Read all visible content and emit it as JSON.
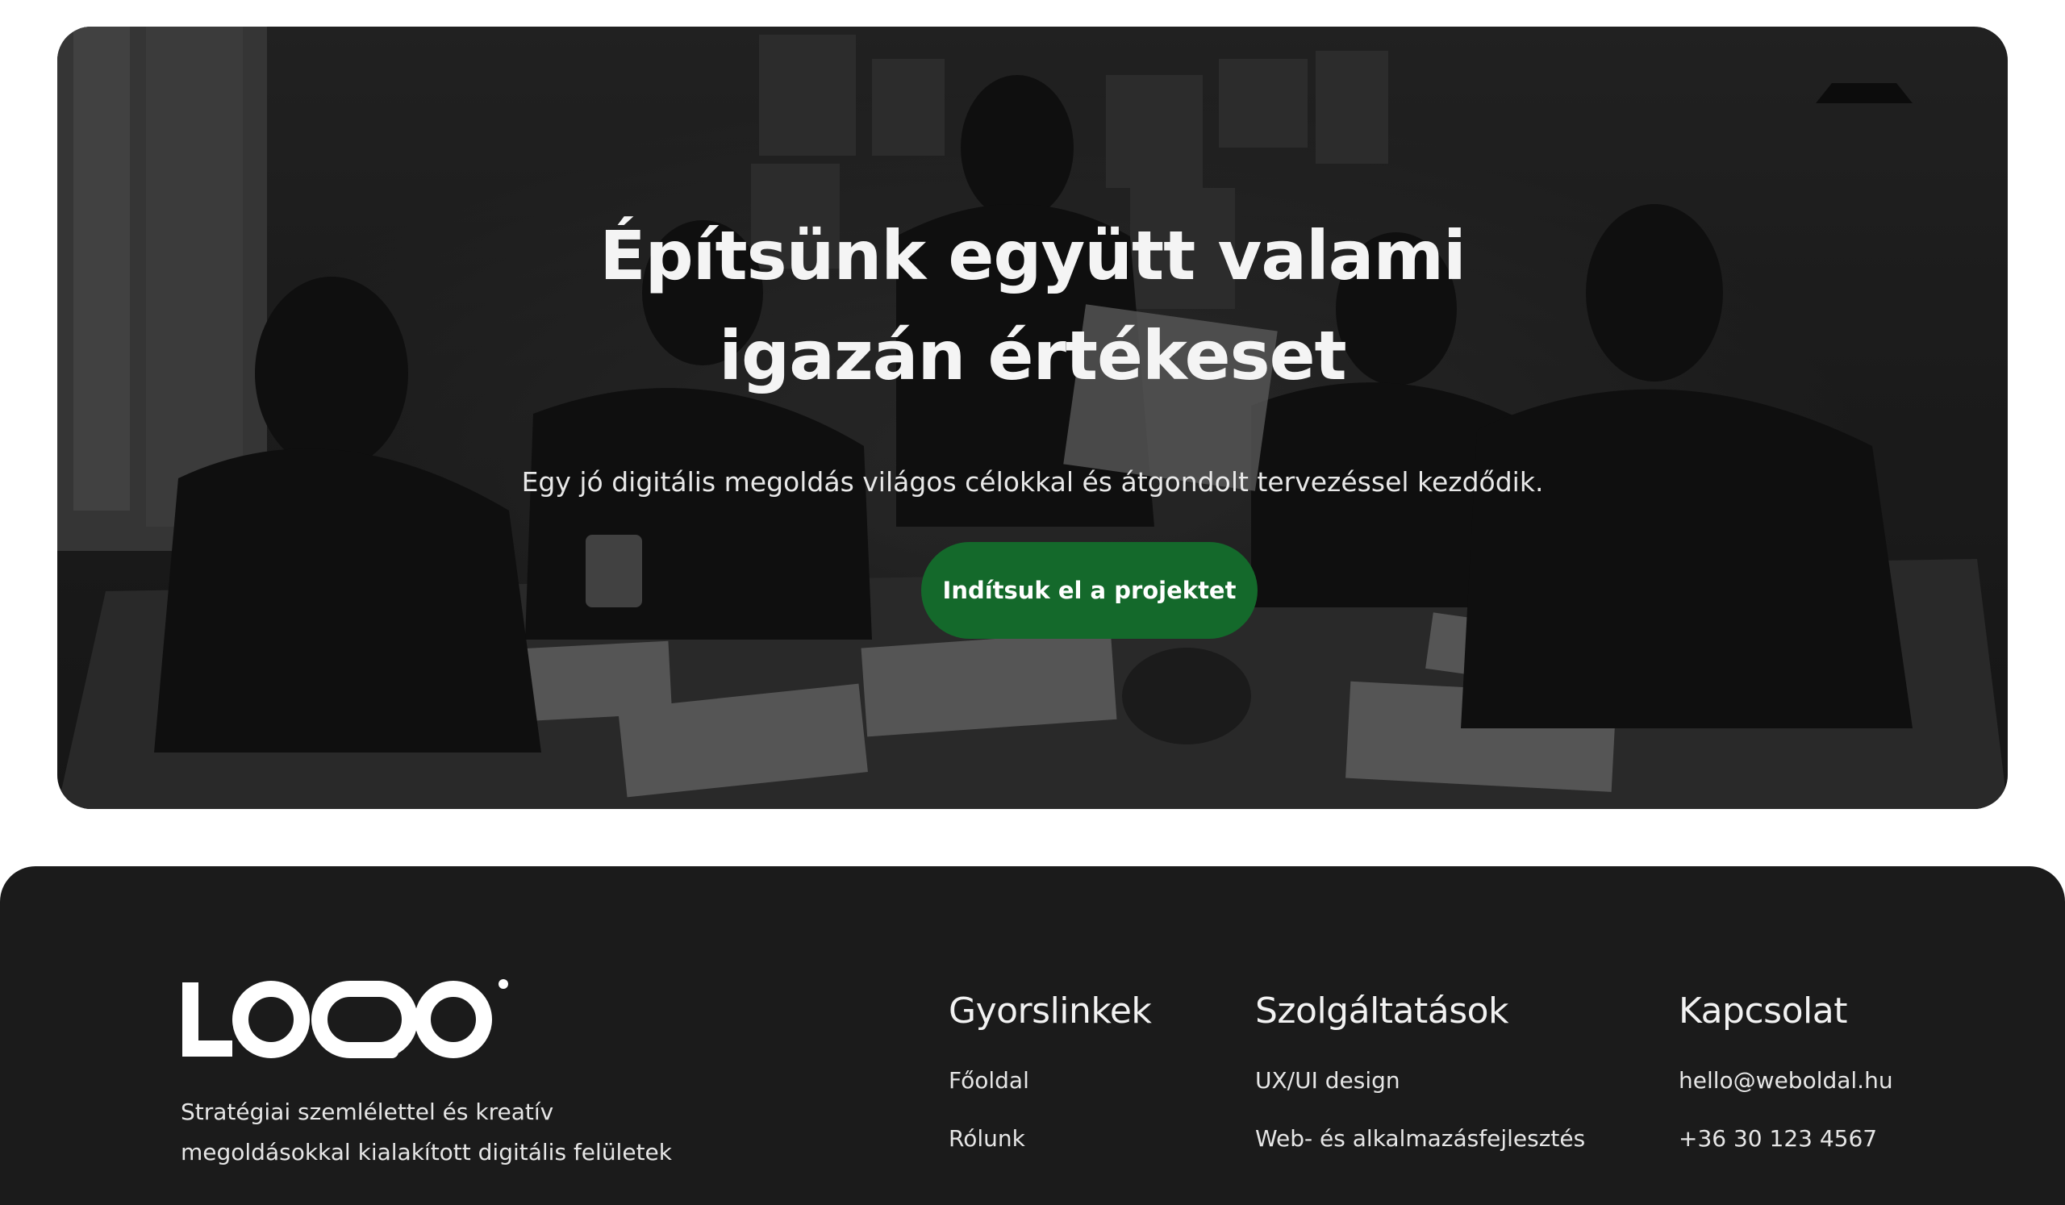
{
  "hero": {
    "title_line1": "Építsünk együtt valami",
    "title_line2": "igazán értékeset",
    "subtitle": "Egy jó digitális megoldás világos célokkal és átgondolt tervezéssel kezdődik.",
    "cta_label": "Indítsuk el a projektet",
    "background": "team-meeting-photo",
    "cta_color": "#14692b"
  },
  "footer": {
    "logo_text": "LOGO",
    "description": "Stratégiai szemlélettel és kreatív megoldásokkal kialakított digitális felületek",
    "columns": [
      {
        "title": "Gyorslinkek",
        "links": [
          "Főoldal",
          "Rólunk"
        ]
      },
      {
        "title": "Szolgáltatások",
        "links": [
          "UX/UI design",
          "Web- és alkalmazásfejlesztés"
        ]
      },
      {
        "title": "Kapcsolat",
        "links": [
          "hello@weboldal.hu",
          "+36 30 123 4567"
        ]
      }
    ],
    "background_color": "#1b1b1b"
  }
}
